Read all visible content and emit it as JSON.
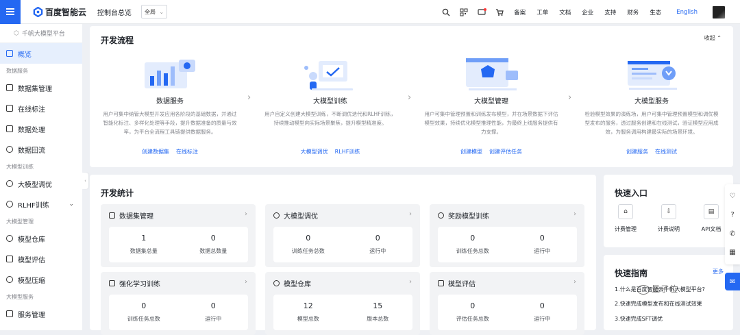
{
  "topbar": {
    "logo_text": "百度智能云",
    "console_title": "控制台总览",
    "region": "全局",
    "nav": [
      "备案",
      "工单",
      "文档",
      "企业",
      "支持",
      "财务",
      "生态"
    ],
    "lang": "English"
  },
  "sidebar": {
    "platform": "千帆大模型平台",
    "overview": "概览",
    "groups": [
      {
        "label": "数据服务",
        "items": [
          "数据集管理",
          "在线标注",
          "数据处理",
          "数据回流"
        ]
      },
      {
        "label": "大模型训练",
        "items": [
          "大模型调优",
          "RLHF训练"
        ]
      },
      {
        "label": "大模型管理",
        "items": [
          "模型仓库",
          "模型评估",
          "模型压缩"
        ]
      },
      {
        "label": "大模型服务",
        "items": [
          "服务管理"
        ]
      }
    ]
  },
  "flow": {
    "title": "开发流程",
    "collapse": "收起",
    "steps": [
      {
        "title": "数据服务",
        "desc": "用户可集中纳管大模型开发应用各阶段的基础数据，并通过智能化标注、多样化处理等手段，提升数据准备的质量与效率，为平台全流程工具链提供数据服务。",
        "links": [
          "创建数据集",
          "在线标注"
        ]
      },
      {
        "title": "大模型训练",
        "desc": "用户自定义创建大模型训练，不断调优迭代和RLHF训练，持续推动模型向实际场景聚焦，提升模型精准度。",
        "links": [
          "大模型调优",
          "RLHF训练"
        ]
      },
      {
        "title": "大模型管理",
        "desc": "用户可集中管理预置和训练发布模型，并在场景数据下评估模型效果，持续优化模型推理性能，为最终上线服务提供有力支撑。",
        "links": [
          "创建模型",
          "创建评估任务"
        ]
      },
      {
        "title": "大模型服务",
        "desc": "检验模型效果的演练场，用户可集中管理预置模型和调优模型发布的服务，透过服务创建和在线测试，验证模型应用成效，为服务调用构建最实际的场景环境。",
        "links": [
          "创建服务",
          "在线测试"
        ]
      }
    ]
  },
  "stats": {
    "title": "开发统计",
    "cards": [
      {
        "title": "数据集管理",
        "a_val": "1",
        "a_lbl": "数据集总量",
        "b_val": "0",
        "b_lbl": "数据总数量"
      },
      {
        "title": "大模型调优",
        "a_val": "0",
        "a_lbl": "训练任务总数",
        "b_val": "0",
        "b_lbl": "运行中"
      },
      {
        "title": "奖励模型训练",
        "a_val": "0",
        "a_lbl": "训练任务总数",
        "b_val": "0",
        "b_lbl": "运行中"
      },
      {
        "title": "强化学习训练",
        "a_val": "0",
        "a_lbl": "训练任务总数",
        "b_val": "0",
        "b_lbl": "运行中"
      },
      {
        "title": "模型仓库",
        "a_val": "12",
        "a_lbl": "模型总数",
        "b_val": "15",
        "b_lbl": "版本总数"
      },
      {
        "title": "模型评估",
        "a_val": "0",
        "a_lbl": "评估任务总数",
        "b_val": "0",
        "b_lbl": "运行中"
      }
    ]
  },
  "quick": {
    "title": "快速入口",
    "items": [
      "计费管理",
      "计费说明",
      "API文档"
    ]
  },
  "guide": {
    "title": "快速指南",
    "more": "更多",
    "items": [
      "1.什么是百度智能云千帆大模型平台?",
      "2.快速完成模型发布和在线测试效果",
      "3.快速完成SFT调优"
    ]
  },
  "watermark": "量子位",
  "colors": {
    "accent": "#2468f2",
    "bg": "#eef0f4"
  }
}
